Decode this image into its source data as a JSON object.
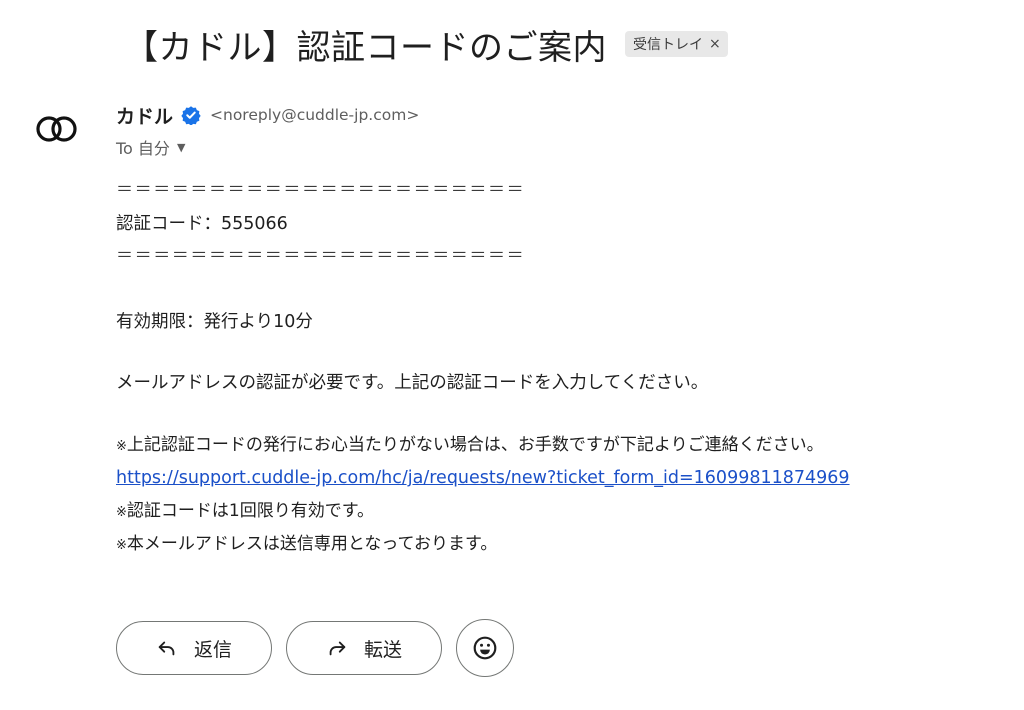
{
  "subject": "【カドル】認証コードのご案内",
  "label_chip": {
    "text": "受信トレイ",
    "close": "×"
  },
  "sender": {
    "name": "カドル",
    "email": "<noreply@cuddle-jp.com>"
  },
  "recipient": {
    "text": "To 自分",
    "caret": "▼"
  },
  "body": {
    "rule_top": "＝＝＝＝＝＝＝＝＝＝＝＝＝＝＝＝＝＝＝＝＝＝",
    "code_line": "認証コード：555066",
    "rule_bottom": "＝＝＝＝＝＝＝＝＝＝＝＝＝＝＝＝＝＝＝＝＝＝",
    "expiry": "有効期限：発行より10分",
    "instruction": "メールアドレスの認証が必要です。上記の認証コードを入力してください。",
    "note_mark": "※",
    "note1": "上記認証コードの発行にお心当たりがない場合は、お手数ですが下記よりご連絡ください。",
    "support_link": "https://support.cuddle-jp.com/hc/ja/requests/new?ticket_form_id=16099811874969",
    "note2": "認証コードは1回限り有効です。",
    "note3": "本メールアドレスは送信専用となっております。"
  },
  "actions": {
    "reply": "返信",
    "forward": "転送"
  },
  "colors": {
    "verified_badge": "#1a73e8",
    "link": "#1b50c8",
    "chip_bg": "#e8e8e8"
  },
  "icons": [
    "two-rings-logo-icon",
    "verified-badge-icon",
    "reply-arrow-icon",
    "forward-arrow-icon",
    "smiley-emoji-icon"
  ]
}
